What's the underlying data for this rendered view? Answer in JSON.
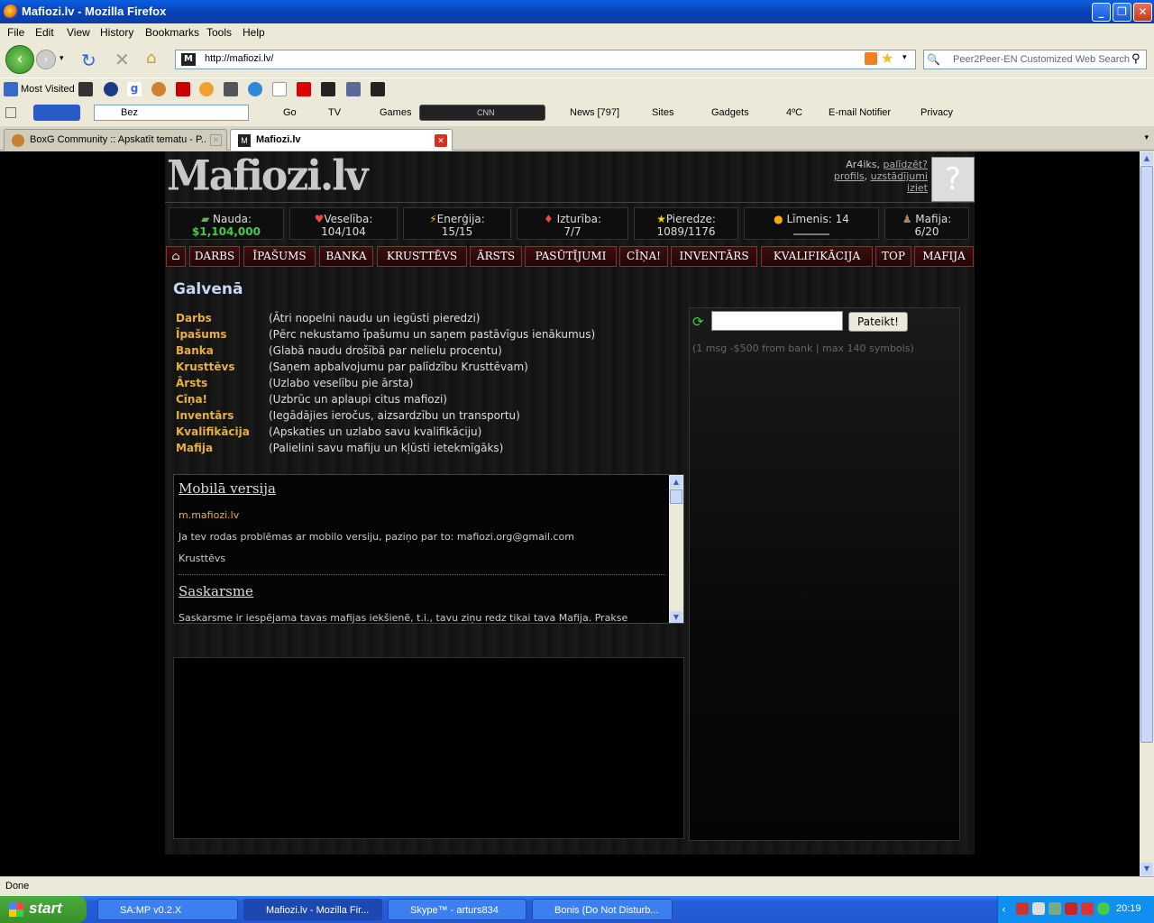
{
  "window": {
    "title": "Mafiozi.lv - Mozilla Firefox"
  },
  "menu": [
    "File",
    "Edit",
    "View",
    "History",
    "Bookmarks",
    "Tools",
    "Help"
  ],
  "nav": {
    "url": "http://mafiozi.lv/",
    "search_placeholder": "Peer2Peer-EN Customized Web Search"
  },
  "bookmarks": {
    "most_visited": "Most Visited"
  },
  "toolbar2": {
    "search_engine": "Bez",
    "go": "Go",
    "tv": "TV",
    "games": "Games",
    "radio": "CNN",
    "news": "News [797]",
    "sites": "Sites",
    "gadgets": "Gadgets",
    "weather": "4ºC",
    "email": "E-mail Notifier",
    "privacy": "Privacy"
  },
  "tabs": [
    {
      "label": "BoxG Community :: Apskatīt tematu - P..."
    },
    {
      "label": "Mafiozi.lv"
    }
  ],
  "site": {
    "logo": "Mafiozi.lv",
    "user": {
      "name": "Ar4iks,",
      "help": "palīdzēt?",
      "profile": "profils",
      "settings": "uzstādījumi",
      "logout": "iziet"
    },
    "stats": [
      {
        "label": "Nauda:",
        "value": "$1,104,000"
      },
      {
        "label": "Veselība:",
        "value": "104/104"
      },
      {
        "label": "Enerģija:",
        "value": "15/15"
      },
      {
        "label": "Izturība:",
        "value": "7/7"
      },
      {
        "label": "Pieredze:",
        "value": "1089/1176"
      },
      {
        "label": "Līmenis: 14",
        "value": ""
      },
      {
        "label": "Mafija:",
        "value": "6/20"
      }
    ],
    "nav": [
      "DARBS",
      "ĪPAŠUMS",
      "BANKA",
      "KRUSTTĒVS",
      "ĀRSTS",
      "PASŪTĪJUMI",
      "CĪŅA!",
      "INVENTĀRS",
      "KVALIFIKĀCIJA",
      "TOP",
      "MAFIJA"
    ],
    "page_title": "Galvenā",
    "menu": [
      {
        "key": "Darbs",
        "desc": "(Ātri nopelni naudu un iegūsti pieredzi)"
      },
      {
        "key": "Īpašums",
        "desc": "(Pērc nekustamo īpašumu un saņem pastāvīgus ienākumus)"
      },
      {
        "key": "Banka",
        "desc": "(Glabā naudu drošībā par nelielu procentu)"
      },
      {
        "key": "Krusttēvs",
        "desc": "(Saņem apbalvojumu par palīdzību Krusttēvam)"
      },
      {
        "key": "Ārsts",
        "desc": "(Uzlabo veselību pie ārsta)"
      },
      {
        "key": "Cīņa!",
        "desc": "(Uzbrūc un aplaupi citus mafiozi)"
      },
      {
        "key": "Inventārs",
        "desc": "(Iegādājies ieročus, aizsardzību un transportu)"
      },
      {
        "key": "Kvalifikācija",
        "desc": "(Apskaties un uzlabo savu kvalifikāciju)"
      },
      {
        "key": "Mafija",
        "desc": "(Palielini savu mafiju un kļūsti ietekmīgāks)"
      }
    ],
    "news": {
      "h1": "Mobilā versija",
      "link": "m.mafiozi.lv",
      "p1": "Ja tev rodas problēmas ar mobilo versiju, paziņo par to: mafiozi.org@gmail.com",
      "sig": "Krusttēvs",
      "h2": "Saskarsme",
      "p2": "Saskarsme ir iespējama tavas mafijas iekšienē, t.i., tavu ziņu redz tikai tava Mafija. Prakse"
    },
    "chat": {
      "button": "Pateikt!",
      "info": "(1 msg -$500 from bank | max 140 symbols)"
    }
  },
  "status": "Done",
  "taskbar": {
    "start": "start",
    "items": [
      "SA:MP v0.2.X",
      "Mafiozi.lv - Mozilla Fir...",
      "Skype™ - arturs834",
      "Bonis (Do Not Disturb..."
    ],
    "clock": "20:19"
  }
}
